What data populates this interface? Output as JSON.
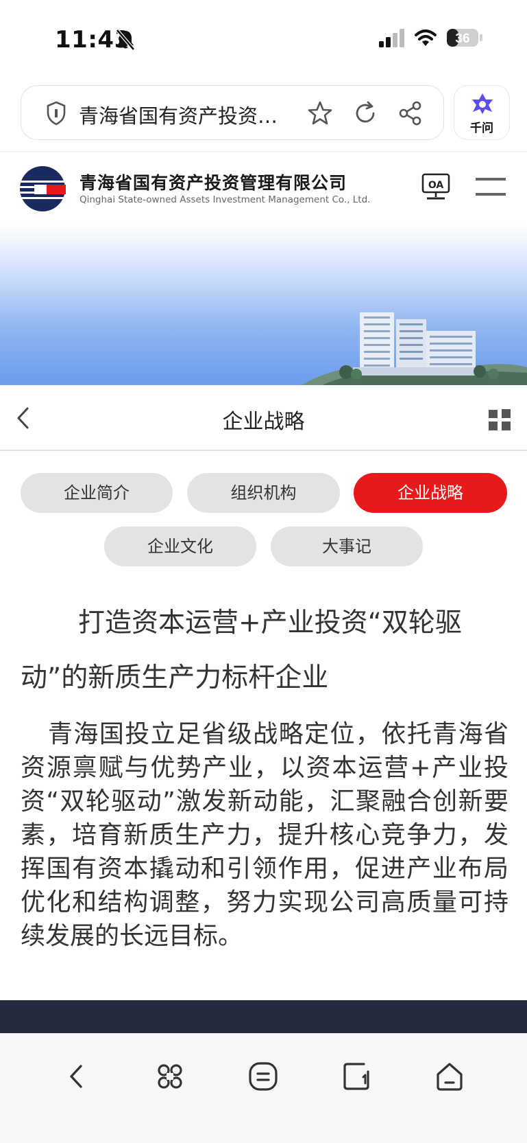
{
  "status_bar": {
    "time": "11:43",
    "battery": "36",
    "icons": [
      "bell-off-icon",
      "signal-icon",
      "wifi-icon",
      "battery-icon"
    ]
  },
  "browser": {
    "address_text": "青海省国有资产投资…",
    "assistant_label": "千问",
    "icons": [
      "shield-icon",
      "star-icon",
      "reload-icon",
      "share-icon",
      "qianwen-logo-icon"
    ]
  },
  "site": {
    "name_cn": "青海省国有资产投资管理有限公司",
    "name_en": "Qinghai State-owned Assets Investment Management Co., Ltd.",
    "oa_label": "OA",
    "icons": [
      "oa-icon",
      "menu-icon"
    ]
  },
  "page": {
    "title": "企业战略"
  },
  "tabs": [
    {
      "label": "企业简介",
      "active": false
    },
    {
      "label": "组织机构",
      "active": false
    },
    {
      "label": "企业战略",
      "active": true
    },
    {
      "label": "企业文化",
      "active": false
    },
    {
      "label": "大事记",
      "active": false
    }
  ],
  "content": {
    "heading": "打造资本运营+产业投资“双轮驱动”的新质生产力标杆企业",
    "body": "青海国投立足省级战略定位，依托青海省资源禀赋与优势产业，以资本运营+产业投资“双轮驱动”激发新动能，汇聚融合创新要素，培育新质生产力，提升核心竞争力，发挥国有资本撬动和引领作用，促进产业布局优化和结构调整，努力实现公司高质量可持续发展的长远目标。"
  },
  "bottom_nav": [
    "back-icon",
    "apps-icon",
    "tabs-list-icon",
    "tabs-icon",
    "home-icon"
  ],
  "colors": {
    "accent_red": "#e8191b",
    "tab_inactive": "#e3e3e3",
    "footer": "#262a3f",
    "logo_navy": "#1b2a5e"
  }
}
